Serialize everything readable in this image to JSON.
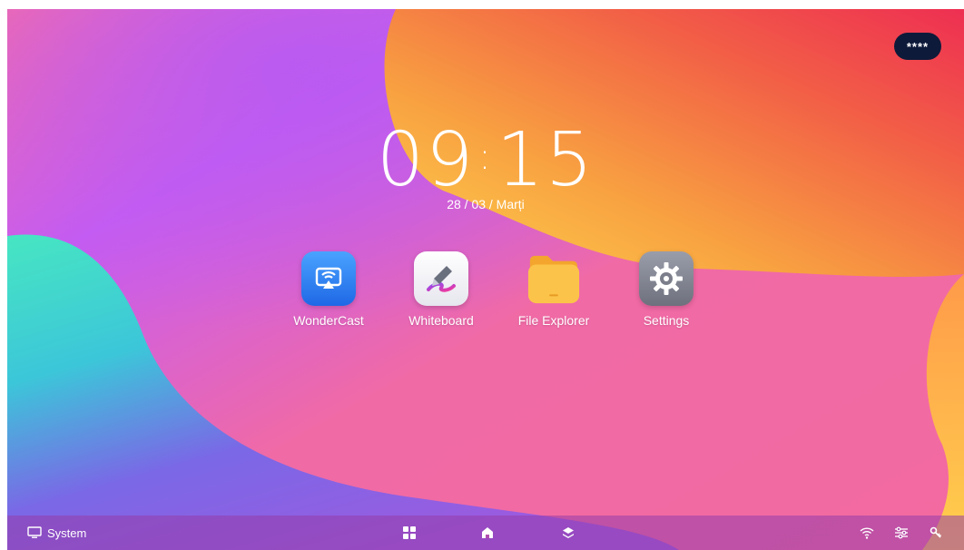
{
  "lock_badge": {
    "text": "****"
  },
  "clock": {
    "hours": "09",
    "separator": ":",
    "minutes": "15"
  },
  "date": {
    "text": "28 / 03 / Marți"
  },
  "apps": [
    {
      "label": "WonderCast",
      "icon": "wondercast-icon",
      "color": "#2f7cf2"
    },
    {
      "label": "Whiteboard",
      "icon": "whiteboard-icon",
      "color": "#f2f2f6"
    },
    {
      "label": "File Explorer",
      "icon": "folder-icon",
      "color": "#f8b93a"
    },
    {
      "label": "Settings",
      "icon": "gear-icon",
      "color": "#8a8d99"
    }
  ],
  "taskbar": {
    "system_label": "System",
    "center_icons": [
      "apps-grid-icon",
      "home-icon",
      "layers-icon"
    ],
    "right_icons": [
      "wifi-icon",
      "sliders-icon",
      "key-icon"
    ]
  },
  "colors": {
    "accent_dark": "#0e1a3a",
    "taskbar": "#963caa"
  }
}
